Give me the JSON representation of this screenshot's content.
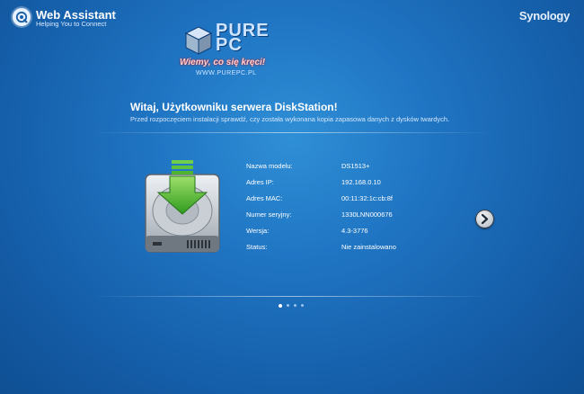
{
  "app": {
    "title": "Web Assistant",
    "subtitle": "Helping You to Connect",
    "brand": "Synology"
  },
  "overlay_logo": {
    "name": "PURE PC",
    "tagline": "Wiemy, co się kręci!",
    "url": "WWW.PUREPC.PL"
  },
  "welcome": {
    "title": "Witaj, Użytkowniku serwera DiskStation!",
    "subtitle": "Przed rozpoczęciem instalacji sprawdź, czy została wykonana kopia zapasowa danych z dysków twardych."
  },
  "device": {
    "rows": [
      {
        "label": "Nazwa modelu:",
        "value": "DS1513+"
      },
      {
        "label": "Adres IP:",
        "value": "192.168.0.10"
      },
      {
        "label": "Adres MAC:",
        "value": "00:11:32:1c:cb:8f"
      },
      {
        "label": "Numer seryjny:",
        "value": "1330LNN000676"
      },
      {
        "label": "Wersja:",
        "value": "4.3-3776"
      },
      {
        "label": "Status:",
        "value": "Nie zainstalowano"
      }
    ]
  },
  "pager": {
    "count": 4,
    "active_index": 0
  },
  "icons": {
    "app_icon": "web-assistant-icon",
    "drive": "hard-drive-install-icon",
    "next": "chevron-right-icon"
  }
}
